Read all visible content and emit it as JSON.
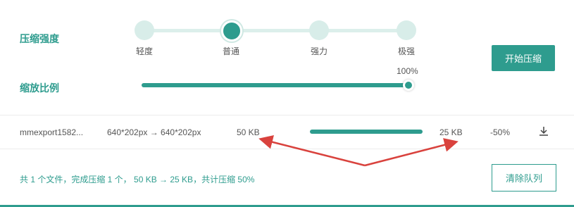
{
  "compression": {
    "label": "压缩强度",
    "levels": [
      "轻度",
      "普通",
      "强力",
      "极强"
    ],
    "selected": "普通"
  },
  "scale": {
    "label": "缩放比例",
    "value_text": "100%",
    "value": 100
  },
  "actions": {
    "start_label": "开始压缩",
    "clear_label": "清除队列"
  },
  "file_row": {
    "name": "mmexport1582...",
    "dimensions": "640*202px → 640*202px",
    "original_size": "50 KB",
    "progress": 1.0,
    "compressed_size": "25 KB",
    "reduction": "-50%",
    "download_icon": "download-icon"
  },
  "footer": {
    "summary": "共 1 个文件，完成压缩 1 个， 50 KB → 25 KB，共计压缩 50%"
  },
  "colors": {
    "accent": "#2e9c8e",
    "track": "#dcefeb",
    "arrow": "#d9423d"
  }
}
